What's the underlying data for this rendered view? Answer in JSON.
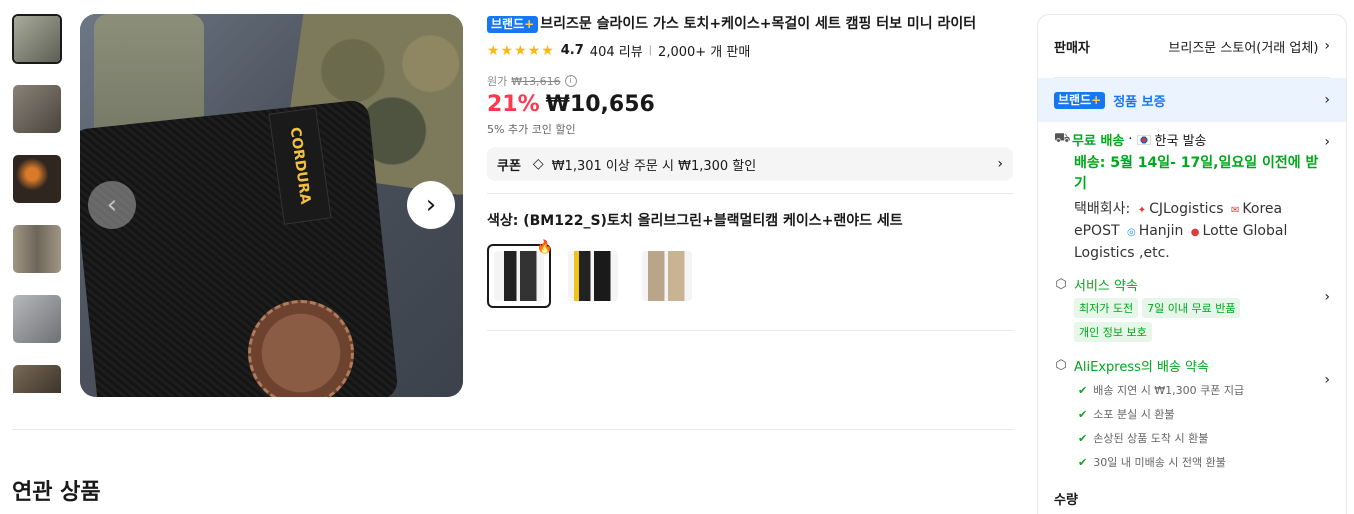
{
  "thumbnails": [
    {
      "name": "thumb-1",
      "color": "#8a8b7f",
      "active": true
    },
    {
      "name": "thumb-2",
      "color": "#6a6258"
    },
    {
      "name": "thumb-3",
      "color": "#3a3028"
    },
    {
      "name": "thumb-4",
      "color": "#7a7466"
    },
    {
      "name": "thumb-5",
      "color": "#8f9094"
    },
    {
      "name": "thumb-6",
      "color": "#5a5046"
    }
  ],
  "product": {
    "brand_badge": "브랜드",
    "brand_plus": "+",
    "title": "브리즈문 슬라이드 가스 토치+케이스+목걸이 세트 캠핑 터보 미니 라이터",
    "stars": "★★★★★",
    "rating": "4.7",
    "reviews": "404 리뷰",
    "sold": "2,000+ 개 판매",
    "orig_label": "원가",
    "orig_price": "₩13,616",
    "discount": "21%",
    "price": "₩10,656",
    "coin_text": "5% 추가 코인 할인",
    "coupon_label": "쿠폰",
    "coupon_text": "₩1,301 이상 주문 시 ₩1,300 할인",
    "color_label": "색상: (BM122_S)토치 올리브그린+블랙멀티캠 케이스+랜야드 세트",
    "pouch_tag": "CORDURA"
  },
  "related": {
    "title": "연관 상품"
  },
  "panel": {
    "seller_label": "판매자",
    "seller_name": "브리즈문 스토어(거래 업체)",
    "guarantee_badge": "브랜드",
    "guarantee_plus": "+",
    "guarantee_text": "정품 보증",
    "ship_free": "무료 배송",
    "ship_dot": "·",
    "ship_origin": "한국 발송",
    "ship_date": "배송: 5월 14일- 17일,일요일 이전에 받기",
    "carrier_label": "택배회사:",
    "carriers": [
      "CJLogistics",
      "Korea ePOST",
      "Hanjin",
      "Lotte Global Logistics ,etc."
    ],
    "service_title": "서비스 약속",
    "service_pills": [
      "최저가 도전",
      "7일 이내 무료 반품",
      "개인 정보 보호"
    ],
    "promise_title": "AliExpress의 배송 약속",
    "promises": [
      "배송 지연 시 ₩1,300 쿠폰 지급",
      "소포 분실 시 환불",
      "손상된 상품 도착 시 환불",
      "30일 내 미배송 시 전액 환불"
    ],
    "qty_label": "수량"
  },
  "icons": {
    "prev": "‹",
    "next": "›",
    "chevron": "›",
    "info": "i",
    "coupon": "◇",
    "truck": "⛟",
    "box": "⬡",
    "check": "✔",
    "hot": "🔥"
  },
  "colors": {
    "accent_red": "#fd384f",
    "brand_blue": "#1777f2",
    "green": "#00a71c",
    "star": "#fdb913"
  }
}
